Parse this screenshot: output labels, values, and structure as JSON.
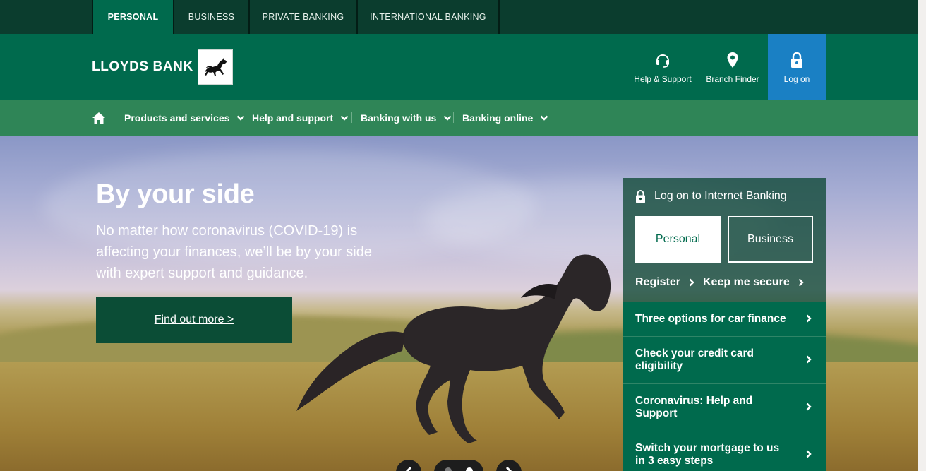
{
  "brand_tabs": [
    {
      "label": "PERSONAL",
      "active": true
    },
    {
      "label": "BUSINESS",
      "active": false
    },
    {
      "label": "PRIVATE BANKING",
      "active": false
    },
    {
      "label": "INTERNATIONAL BANKING",
      "active": false
    }
  ],
  "header": {
    "logo_text": "LLOYDS BANK",
    "logo_icon": "black-horse-logo",
    "utilities": {
      "help": {
        "label": "Help & Support",
        "icon": "headset-icon"
      },
      "branch": {
        "label": "Branch Finder",
        "icon": "location-pin-icon"
      },
      "logon": {
        "label": "Log on",
        "icon": "padlock-icon"
      }
    }
  },
  "nav": {
    "home_icon": "home-icon",
    "items": [
      {
        "label": "Products and services"
      },
      {
        "label": "Help and support"
      },
      {
        "label": "Banking with us"
      },
      {
        "label": "Banking online"
      }
    ]
  },
  "hero": {
    "title": "By your side",
    "text": "No matter how coronavirus (COVID-19) is affecting your finances, we’ll be by your side with expert support and guidance.",
    "cta": "Find out more >",
    "carousel": {
      "slide_count": 2,
      "active_slide": 2
    }
  },
  "logon_panel": {
    "title": "Log on to Internet Banking",
    "personal_label": "Personal",
    "business_label": "Business",
    "register_label": "Register",
    "secure_label": "Keep me secure"
  },
  "promos": [
    {
      "label": "Three options for car finance"
    },
    {
      "label": "Check your credit card eligibility"
    },
    {
      "label": "Coronavirus: Help and Support"
    },
    {
      "label": "Switch your mortgage to us in 3 easy steps"
    }
  ],
  "colors": {
    "brand_green": "#006a4d",
    "dark_green": "#0b3d2e",
    "nav_green": "#2f8557",
    "logon_blue": "#1a80c4"
  }
}
